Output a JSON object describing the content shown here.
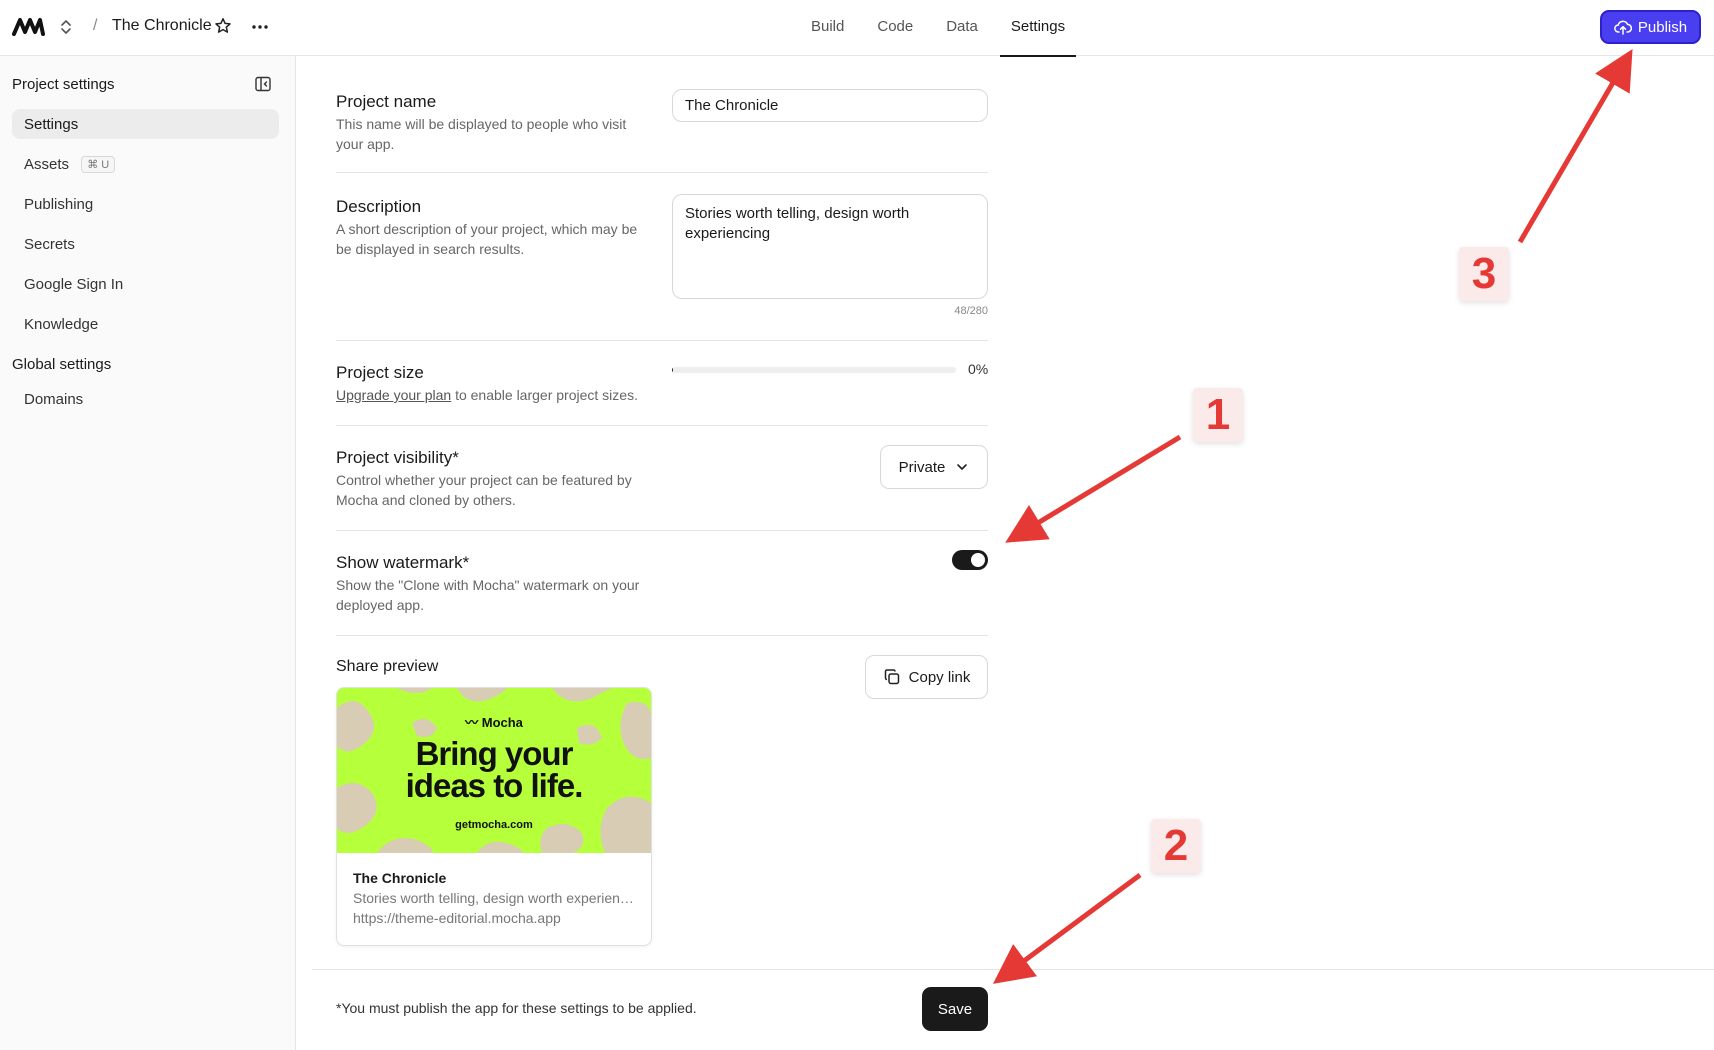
{
  "topbar": {
    "project_title": "The Chronicle",
    "breadcrumb_sep": "/",
    "tabs": [
      {
        "label": "Build"
      },
      {
        "label": "Code"
      },
      {
        "label": "Data"
      },
      {
        "label": "Settings",
        "active": true
      }
    ],
    "publish_label": "Publish"
  },
  "sidebar": {
    "heading": "Project settings",
    "items": [
      {
        "label": "Settings",
        "active": true
      },
      {
        "label": "Assets",
        "shortcut": "⌘ U"
      },
      {
        "label": "Publishing"
      },
      {
        "label": "Secrets"
      },
      {
        "label": "Google Sign In"
      },
      {
        "label": "Knowledge"
      }
    ],
    "global_heading": "Global settings",
    "global_items": [
      {
        "label": "Domains"
      }
    ]
  },
  "settings": {
    "project_name": {
      "label": "Project name",
      "desc": "This name will be displayed to people who visit your app.",
      "value": "The Chronicle"
    },
    "description": {
      "label": "Description",
      "desc": "A short description of your project, which may be be displayed in search results.",
      "value": "Stories worth telling, design worth experiencing",
      "counter": "48/280"
    },
    "project_size": {
      "label": "Project size",
      "desc_link": "Upgrade your plan",
      "desc_rest": " to enable larger project sizes.",
      "percent_label": "0%",
      "percent_value": 0
    },
    "visibility": {
      "label": "Project visibility*",
      "desc": "Control whether your project can be featured by Mocha and cloned by others.",
      "selected": "Private"
    },
    "watermark": {
      "label": "Show watermark*",
      "desc": "Show the \"Clone with Mocha\" watermark on your deployed app.",
      "enabled": true
    },
    "share_preview": {
      "label": "Share preview",
      "copy_label": "Copy link",
      "image_brand": "Mocha",
      "image_headline_1": "Bring your",
      "image_headline_2": "ideas to life.",
      "image_url": "getmocha.com",
      "card_title": "The Chronicle",
      "card_desc": "Stories worth telling, design worth experiencing",
      "card_link": "https://theme-editorial.mocha.app"
    }
  },
  "footer": {
    "note": "*You must publish the app for these settings to be applied.",
    "save_label": "Save"
  },
  "annotations": {
    "badge_1": "1",
    "badge_2": "2",
    "badge_3": "3",
    "arrow_color": "#e53935"
  },
  "colors": {
    "publish_bg": "#4a3ff0",
    "preview_bg": "#b6ff3b",
    "preview_blob": "#d9ccb4"
  }
}
